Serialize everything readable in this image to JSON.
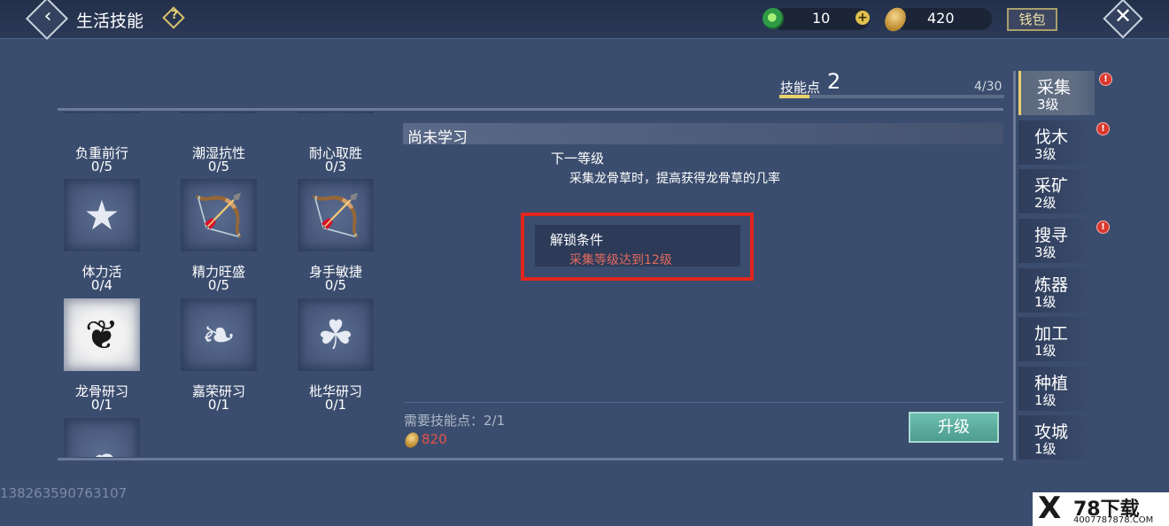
{
  "header": {
    "title": "生活技能",
    "help_icon": "?",
    "jade_value": "10",
    "coin_value": "420",
    "wallet_label": "钱包"
  },
  "skill_points": {
    "label": "技能点",
    "value": "2",
    "progress_text": "4/30",
    "progress_fraction": 0.133
  },
  "skills": [
    {
      "name": "负重前行",
      "level": "0/5",
      "icon": "shield-icon"
    },
    {
      "name": "潮湿抗性",
      "level": "0/5",
      "icon": "shield-icon"
    },
    {
      "name": "耐心取胜",
      "level": "0/3",
      "icon": "shield-icon"
    },
    {
      "name": "体力活",
      "level": "0/4",
      "icon": "star-banner-icon"
    },
    {
      "name": "精力旺盛",
      "level": "0/5",
      "icon": "bow-arrow-icon"
    },
    {
      "name": "身手敏捷",
      "level": "0/5",
      "icon": "bow-arrow-icon"
    },
    {
      "name": "龙骨研习",
      "level": "0/1",
      "icon": "fern-leaf-icon"
    },
    {
      "name": "嘉荣研习",
      "level": "0/1",
      "icon": "herb-sprig-icon"
    },
    {
      "name": "枇华研习",
      "level": "0/1",
      "icon": "leaf-branch-icon"
    },
    {
      "name": "",
      "level": "",
      "icon": "mushroom-icon"
    }
  ],
  "detail": {
    "title": "尚未学习",
    "next_label": "下一等级",
    "next_desc": "采集龙骨草时，提高获得龙骨草的几率",
    "unlock_label": "解锁条件",
    "unlock_condition": "采集等级达到12级",
    "need_label": "需要技能点：2/1",
    "cost": "820",
    "upgrade_label": "升级"
  },
  "tabs": [
    {
      "name": "采集",
      "level": "3级",
      "alert": true,
      "selected": true
    },
    {
      "name": "伐木",
      "level": "3级",
      "alert": true,
      "selected": false
    },
    {
      "name": "采矿",
      "level": "2级",
      "alert": false,
      "selected": false
    },
    {
      "name": "搜寻",
      "level": "3级",
      "alert": true,
      "selected": false
    },
    {
      "name": "炼器",
      "level": "1级",
      "alert": false,
      "selected": false
    },
    {
      "name": "加工",
      "level": "1级",
      "alert": false,
      "selected": false
    },
    {
      "name": "种植",
      "level": "1级",
      "alert": false,
      "selected": false
    },
    {
      "name": "攻城",
      "level": "1级",
      "alert": false,
      "selected": false
    }
  ],
  "uid": "138263590763107",
  "watermark": {
    "logo": "X",
    "text": "78下载",
    "url": "4007787878.COM"
  },
  "colors": {
    "background": "#3b4d6e",
    "accent_gold": "#e8d36a",
    "alert_red": "#e26a5e",
    "highlight_box": "#e1261c",
    "upgrade_button": "#5fb0a2"
  }
}
